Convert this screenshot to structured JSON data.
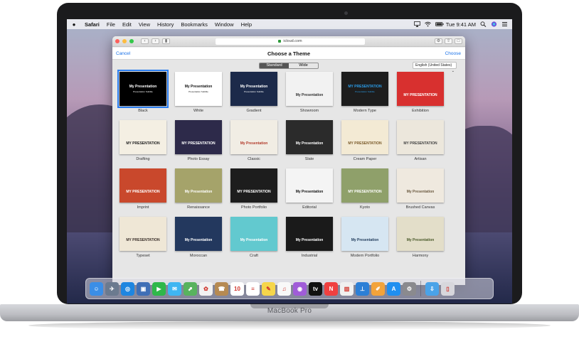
{
  "device": {
    "brand": "MacBook Pro"
  },
  "menubar": {
    "app": "Safari",
    "items": [
      "File",
      "Edit",
      "View",
      "History",
      "Bookmarks",
      "Window",
      "Help"
    ],
    "clock": "Tue 9:41 AM"
  },
  "browser": {
    "url": "icloud.com"
  },
  "chooser": {
    "cancel": "Cancel",
    "title": "Choose a Theme",
    "choose": "Choose",
    "segments": {
      "standard": "Standard",
      "wide": "Wide"
    },
    "language": "English (United States)"
  },
  "themes": [
    {
      "caption": "Black",
      "slide_title": "My Presentation",
      "slide_sub": "Presentation Subtitle",
      "bg": "#000000",
      "fg": "#ffffff"
    },
    {
      "caption": "White",
      "slide_title": "My Presentation",
      "slide_sub": "Presentation Subtitle",
      "bg": "#ffffff",
      "fg": "#111111"
    },
    {
      "caption": "Gradient",
      "slide_title": "My Presentation",
      "slide_sub": "Presentation Subtitle",
      "bg": "#1c2a4a",
      "fg": "#ffffff"
    },
    {
      "caption": "Showroom",
      "slide_title": "My Presentation",
      "slide_sub": "",
      "bg": "#f2f2f2",
      "fg": "#333333"
    },
    {
      "caption": "Modern Type",
      "slide_title": "MY PRESENTATION",
      "slide_sub": "Presentation Subtitle",
      "bg": "#1d1d1d",
      "fg": "#2b9be6"
    },
    {
      "caption": "Exhibition",
      "slide_title": "MY PRESENTATION",
      "slide_sub": "",
      "bg": "#d8302f",
      "fg": "#ffffff"
    },
    {
      "caption": "Drafting",
      "slide_title": "MY PRESENTATION",
      "slide_sub": "",
      "bg": "#f4efe3",
      "fg": "#222222"
    },
    {
      "caption": "Photo Essay",
      "slide_title": "MY PRESENTATION",
      "slide_sub": "",
      "bg": "#2d2a4a",
      "fg": "#ffffff"
    },
    {
      "caption": "Classic",
      "slide_title": "My Presentation",
      "slide_sub": "",
      "bg": "#f1ede4",
      "fg": "#b23a2a"
    },
    {
      "caption": "Slate",
      "slide_title": "My Presentation",
      "slide_sub": "",
      "bg": "#2b2b2b",
      "fg": "#ffffff"
    },
    {
      "caption": "Cream Paper",
      "slide_title": "MY PRESENTATION",
      "slide_sub": "",
      "bg": "#f3ead4",
      "fg": "#7a5a2a"
    },
    {
      "caption": "Artisan",
      "slide_title": "MY PRESENTATION",
      "slide_sub": "",
      "bg": "#ece7dc",
      "fg": "#444444"
    },
    {
      "caption": "Imprint",
      "slide_title": "MY PRESENTATION",
      "slide_sub": "",
      "bg": "#c9482c",
      "fg": "#ffffff"
    },
    {
      "caption": "Renaissance",
      "slide_title": "My Presentation",
      "slide_sub": "",
      "bg": "#a5a36a",
      "fg": "#ffffff"
    },
    {
      "caption": "Photo Portfolio",
      "slide_title": "MY PRESENTATION",
      "slide_sub": "",
      "bg": "#1d1d1d",
      "fg": "#ffffff"
    },
    {
      "caption": "Editorial",
      "slide_title": "My Presentation",
      "slide_sub": "",
      "bg": "#f4f4f4",
      "fg": "#111111"
    },
    {
      "caption": "Kyoto",
      "slide_title": "MY PRESENTATION",
      "slide_sub": "",
      "bg": "#8fa06a",
      "fg": "#ffffff"
    },
    {
      "caption": "Brushed Canvas",
      "slide_title": "My Presentation",
      "slide_sub": "",
      "bg": "#efe9df",
      "fg": "#6b5a40"
    },
    {
      "caption": "Typeset",
      "slide_title": "MY PRESENTATION",
      "slide_sub": "",
      "bg": "#efe7d6",
      "fg": "#3a2f2a"
    },
    {
      "caption": "Moroccan",
      "slide_title": "My Presentation",
      "slide_sub": "",
      "bg": "#23385e",
      "fg": "#ffffff"
    },
    {
      "caption": "Craft",
      "slide_title": "My Presentation",
      "slide_sub": "",
      "bg": "#62c9cf",
      "fg": "#ffffff"
    },
    {
      "caption": "Industrial",
      "slide_title": "My Presentation",
      "slide_sub": "",
      "bg": "#1a1a1a",
      "fg": "#ffffff"
    },
    {
      "caption": "Modern Portfolio",
      "slide_title": "My Presentation",
      "slide_sub": "",
      "bg": "#d6e6f2",
      "fg": "#1f3a5a"
    },
    {
      "caption": "Harmony",
      "slide_title": "My Presentation",
      "slide_sub": "",
      "bg": "#e3dec9",
      "fg": "#4a5a2a"
    }
  ],
  "dock": [
    {
      "name": "finder-icon",
      "color": "#3b8ee6",
      "glyph": "☺"
    },
    {
      "name": "launchpad-icon",
      "color": "#6b7a8f",
      "glyph": "✈"
    },
    {
      "name": "safari-icon",
      "color": "#1e86e0",
      "glyph": "◎"
    },
    {
      "name": "photo-booth-icon",
      "color": "#3f6fb6",
      "glyph": "▣"
    },
    {
      "name": "facetime-icon",
      "color": "#2fb84a",
      "glyph": "▶"
    },
    {
      "name": "messages-icon",
      "color": "#3fb6f2",
      "glyph": "✉"
    },
    {
      "name": "maps-icon",
      "color": "#58b35e",
      "glyph": "⬈"
    },
    {
      "name": "photos-icon",
      "color": "#f2f2f2",
      "glyph": "✿"
    },
    {
      "name": "contacts-icon",
      "color": "#b68a52",
      "glyph": "☎"
    },
    {
      "name": "calendar-icon",
      "color": "#ffffff",
      "glyph": "10"
    },
    {
      "name": "reminders-icon",
      "color": "#ffffff",
      "glyph": "≡"
    },
    {
      "name": "notes-icon",
      "color": "#f6d64a",
      "glyph": "✎"
    },
    {
      "name": "music-icon",
      "color": "#f8f8f8",
      "glyph": "♫"
    },
    {
      "name": "podcasts-icon",
      "color": "#a05cd8",
      "glyph": "◉"
    },
    {
      "name": "tv-icon",
      "color": "#111111",
      "glyph": "tv"
    },
    {
      "name": "news-icon",
      "color": "#f04040",
      "glyph": "N"
    },
    {
      "name": "numbers-icon",
      "color": "#f0f0f0",
      "glyph": "▥"
    },
    {
      "name": "keynote-icon",
      "color": "#2c7fd6",
      "glyph": "⊥"
    },
    {
      "name": "pages-icon",
      "color": "#f3a33a",
      "glyph": "✐"
    },
    {
      "name": "app-store-icon",
      "color": "#1f8ff0",
      "glyph": "A"
    },
    {
      "name": "system-preferences-icon",
      "color": "#8a8a8e",
      "glyph": "⚙"
    },
    {
      "name": "downloads-folder-icon",
      "color": "#4aa3e8",
      "glyph": "⇩"
    },
    {
      "name": "trash-icon",
      "color": "#d7d7dc",
      "glyph": "▯"
    }
  ]
}
